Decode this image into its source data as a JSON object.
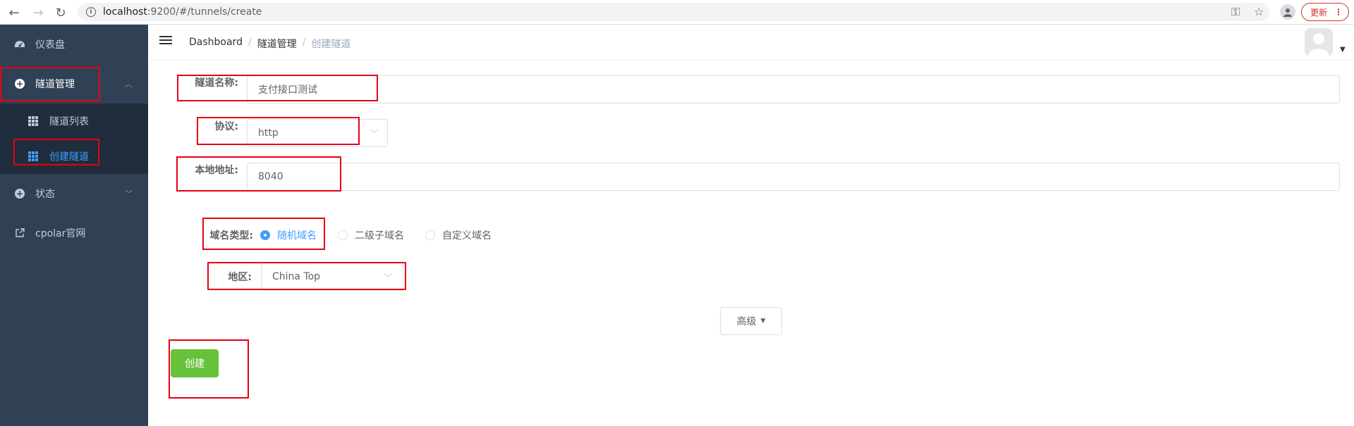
{
  "browser": {
    "url_host": "localhost",
    "url_rest": ":9200/#/tunnels/create",
    "update_label": "更新"
  },
  "sidebar": {
    "items": [
      {
        "label": "仪表盘",
        "icon": "dashboard-icon"
      },
      {
        "label": "隧道管理",
        "icon": "plus-circle-icon"
      },
      {
        "label": "隧道列表",
        "icon": "grid-icon"
      },
      {
        "label": "创建隧道",
        "icon": "grid-icon"
      },
      {
        "label": "状态",
        "icon": "plus-circle-icon"
      },
      {
        "label": "cpolar官网",
        "icon": "external-link-icon"
      }
    ]
  },
  "breadcrumb": {
    "home": "Dashboard",
    "section": "隧道管理",
    "current": "创建隧道"
  },
  "form": {
    "name_label": "隧道名称:",
    "name_value": "支付接口测试",
    "protocol_label": "协议:",
    "protocol_value": "http",
    "local_label": "本地地址:",
    "local_value": "8040",
    "domain_type_label": "域名类型:",
    "domain_options": [
      "随机域名",
      "二级子域名",
      "自定义域名"
    ],
    "domain_selected": "随机域名",
    "region_label": "地区:",
    "region_value": "China Top",
    "advanced_label": "高级",
    "create_label": "创建"
  },
  "colors": {
    "sidebar_bg": "#304156",
    "accent": "#409eff",
    "create_green": "#67c23a",
    "highlight_red": "#e60012"
  }
}
